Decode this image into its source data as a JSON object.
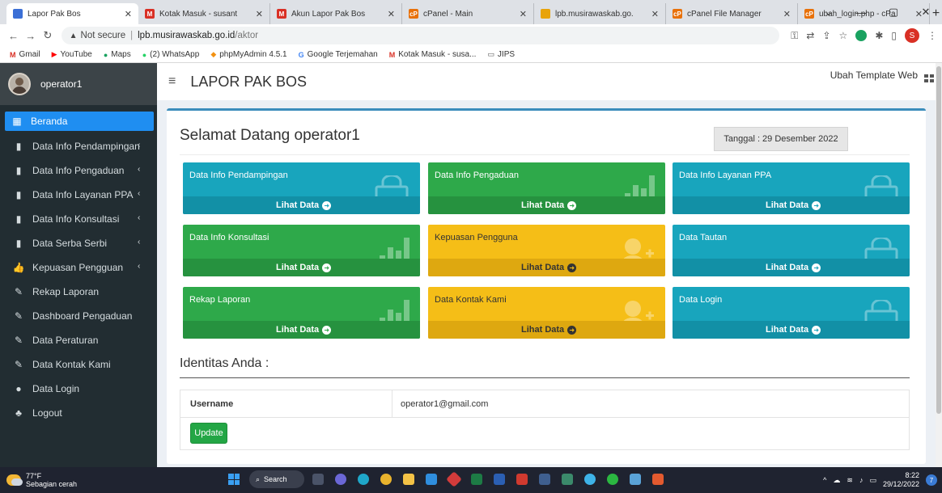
{
  "browser": {
    "tabs": [
      {
        "title": "Lapor Pak Bos",
        "active": true
      },
      {
        "title": "Kotak Masuk - susant"
      },
      {
        "title": "Akun Lapor Pak Bos"
      },
      {
        "title": "cPanel - Main"
      },
      {
        "title": "lpb.musirawaskab.go."
      },
      {
        "title": "cPanel File Manager"
      },
      {
        "title": "ubah_login.php - cPa"
      }
    ],
    "security_label": "Not secure",
    "url_host": "lpb.musirawaskab.go.id",
    "url_path": "/aktor",
    "profile_initial": "S",
    "bookmarks": [
      "Gmail",
      "YouTube",
      "Maps",
      "(2) WhatsApp",
      "phpMyAdmin 4.5.1",
      "Google Terjemahan",
      "Kotak Masuk - susa...",
      "JIPS"
    ]
  },
  "sidebar": {
    "user": "operator1",
    "items": [
      {
        "label": "Beranda",
        "icon": "grid-icon",
        "active": true
      },
      {
        "label": "Data Info Pendampingan",
        "icon": "book-icon",
        "caret": true
      },
      {
        "label": "Data Info Pengaduan",
        "icon": "book-icon",
        "caret": true
      },
      {
        "label": "Data Info Layanan PPA",
        "icon": "book-icon",
        "caret": true
      },
      {
        "label": "Data Info Konsultasi",
        "icon": "book-icon",
        "caret": true
      },
      {
        "label": "Data Serba Serbi",
        "icon": "book-icon",
        "caret": true
      },
      {
        "label": "Kepuasan Pengguan",
        "icon": "thumbs-up-icon",
        "caret": true
      },
      {
        "label": "Rekap Laporan",
        "icon": "edit-icon"
      },
      {
        "label": "Dashboard Pengaduan",
        "icon": "edit-icon"
      },
      {
        "label": "Data Peraturan",
        "icon": "edit-icon"
      },
      {
        "label": "Data Kontak Kami",
        "icon": "edit-icon"
      },
      {
        "label": "Data Login",
        "icon": "user-icon"
      },
      {
        "label": "Logout",
        "icon": "logout-icon"
      }
    ]
  },
  "header": {
    "brand": "LAPOR PAK BOS",
    "template_label": "Ubah Template Web"
  },
  "main": {
    "welcome": "Selamat Datang operator1",
    "date": "Tanggal : 29 Desember 2022",
    "tiles": [
      {
        "title": "Data Info Pendampingan",
        "color": "teal",
        "icon": "bag"
      },
      {
        "title": "Data Info Pengaduan",
        "color": "green",
        "icon": "bar"
      },
      {
        "title": "Data Info Layanan PPA",
        "color": "teal",
        "icon": "bag"
      },
      {
        "title": "Data Info Konsultasi",
        "color": "green",
        "icon": "bar"
      },
      {
        "title": "Kepuasan Pengguna",
        "color": "yellow",
        "icon": "user"
      },
      {
        "title": "Data Tautan",
        "color": "teal",
        "icon": "bag"
      },
      {
        "title": "Rekap Laporan",
        "color": "green",
        "icon": "bar"
      },
      {
        "title": "Data Kontak Kami",
        "color": "yellow",
        "icon": "user"
      },
      {
        "title": "Data Login",
        "color": "teal",
        "icon": "bag"
      }
    ],
    "tile_link": "Lihat Data",
    "identity_title": "Identitas Anda :",
    "username_label": "Username",
    "username_value": "operator1@gmail.com",
    "update_label": "Update"
  },
  "taskbar": {
    "temp": "77°F",
    "weather": "Sebagian cerah",
    "search": "Search",
    "time": "8:22",
    "date": "29/12/2022"
  },
  "colors": {
    "teal": "#18a5bd",
    "green": "#2ea94a",
    "yellow": "#f5be17",
    "sidebar": "#222d32",
    "active": "#1f8ef1"
  }
}
